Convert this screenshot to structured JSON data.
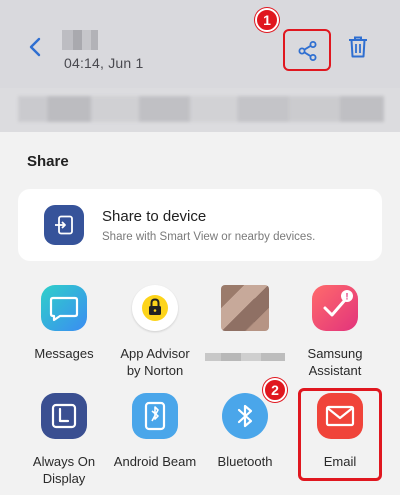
{
  "header": {
    "time": "04:14, Jun 1",
    "step_1": "1",
    "step_2": "2"
  },
  "share_sheet": {
    "title": "Share",
    "device": {
      "title": "Share to device",
      "subtitle": "Share with Smart View or nearby devices."
    },
    "apps": [
      {
        "label": "Messages",
        "icon": "messages-icon"
      },
      {
        "label": "App Advisor\nby Norton",
        "icon": "norton-lock-icon"
      },
      {
        "label": "",
        "icon": "blurred-contact-icon"
      },
      {
        "label": "Samsung\nAssistant",
        "icon": "samsung-assistant-icon"
      },
      {
        "label": "Always On\nDisplay",
        "icon": "always-on-display-icon"
      },
      {
        "label": "Android Beam",
        "icon": "android-beam-icon"
      },
      {
        "label": "Bluetooth",
        "icon": "bluetooth-icon"
      },
      {
        "label": "Email",
        "icon": "email-icon"
      }
    ]
  },
  "colors": {
    "highlight": "#e0171f",
    "accent_blue": "#2f6fd1",
    "email": "#f0443a"
  }
}
